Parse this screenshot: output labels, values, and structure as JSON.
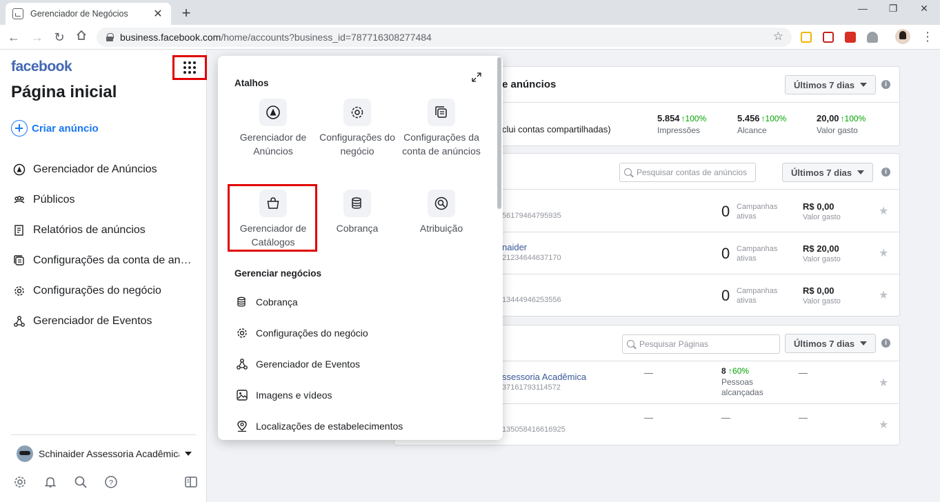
{
  "browser": {
    "tab_title": "Gerenciador de Negócios",
    "tab_close": "✕",
    "new_tab": "+",
    "url_host": "business.facebook.com",
    "url_path": "/home/accounts?business_id=787716308277484",
    "win_minimize": "—",
    "win_restore": "❐",
    "win_close": "✕"
  },
  "sidebar": {
    "logo": "facebook",
    "page_title": "Página inicial",
    "create_ad": "Criar anúncio",
    "items": [
      {
        "label": "Gerenciador de Anúncios",
        "icon": "ads-manager-icon"
      },
      {
        "label": "Públicos",
        "icon": "audiences-icon"
      },
      {
        "label": "Relatórios de anúncios",
        "icon": "ad-reports-icon"
      },
      {
        "label": "Configurações da conta de anúncios",
        "icon": "ad-account-settings-icon"
      },
      {
        "label": "Configurações do negócio",
        "icon": "gear-icon"
      },
      {
        "label": "Gerenciador de Eventos",
        "icon": "events-manager-icon"
      }
    ],
    "account_name": "Schinaider Assessoria Acadêmica"
  },
  "summary_card": {
    "title": "e anúncios",
    "date_range": "Últimos 7 dias",
    "note": "clui contas compartilhadas)",
    "metrics": [
      {
        "value": "5.854",
        "change": "↑100%",
        "label": "Impressões"
      },
      {
        "value": "5.456",
        "change": "↑100%",
        "label": "Alcance"
      },
      {
        "value": "20,00",
        "change": "↑100%",
        "label": "Valor gasto"
      }
    ]
  },
  "accounts_card": {
    "search_placeholder": "Pesquisar contas de anúncios",
    "date_range": "Últimos 7 dias",
    "rows": [
      {
        "name": "",
        "id": "56179464795935",
        "campaigns": "0",
        "campaigns_label": "Campanhas ativas",
        "spend": "R$ 0,00",
        "spend_label": "Valor gasto"
      },
      {
        "name": "naider",
        "id": "21234644637170",
        "campaigns": "0",
        "campaigns_label": "Campanhas ativas",
        "spend": "R$ 20,00",
        "spend_label": "Valor gasto"
      },
      {
        "name": "",
        "id": "13444946253556",
        "campaigns": "0",
        "campaigns_label": "Campanhas ativas",
        "spend": "R$ 0,00",
        "spend_label": "Valor gasto"
      }
    ]
  },
  "pages_card": {
    "search_placeholder": "Pesquisar Páginas",
    "date_range": "Últimos 7 dias",
    "rows": [
      {
        "name": "ssessoria Acadêmica",
        "id": "37161793114572",
        "dash1": "—",
        "reach": "8",
        "reach_change": "↑60%",
        "reach_label": "Pessoas alcançadas",
        "dash3": "—"
      },
      {
        "name": "",
        "id": "135058416616925",
        "dash1": "—",
        "dash2": "—",
        "dash3": "—"
      }
    ]
  },
  "panel": {
    "shortcuts_heading": "Atalhos",
    "shortcuts": [
      {
        "label": "Gerenciador de Anúncios",
        "icon": "ads-manager-icon"
      },
      {
        "label": "Configurações do negócio",
        "icon": "gear-icon"
      },
      {
        "label": "Configurações da conta de anúncios",
        "icon": "ad-account-settings-icon"
      },
      {
        "label": "Gerenciador de Catálogos",
        "icon": "shopping-bag-icon"
      },
      {
        "label": "Cobrança",
        "icon": "billing-icon"
      },
      {
        "label": "Atribuição",
        "icon": "attribution-icon"
      }
    ],
    "manage_heading": "Gerenciar negócios",
    "manage_items": [
      {
        "label": "Cobrança",
        "icon": "billing-icon"
      },
      {
        "label": "Configurações do negócio",
        "icon": "gear-icon"
      },
      {
        "label": "Gerenciador de Eventos",
        "icon": "events-manager-icon"
      },
      {
        "label": "Imagens e vídeos",
        "icon": "image-icon"
      },
      {
        "label": "Localizações de estabelecimentos",
        "icon": "location-icon"
      }
    ]
  }
}
